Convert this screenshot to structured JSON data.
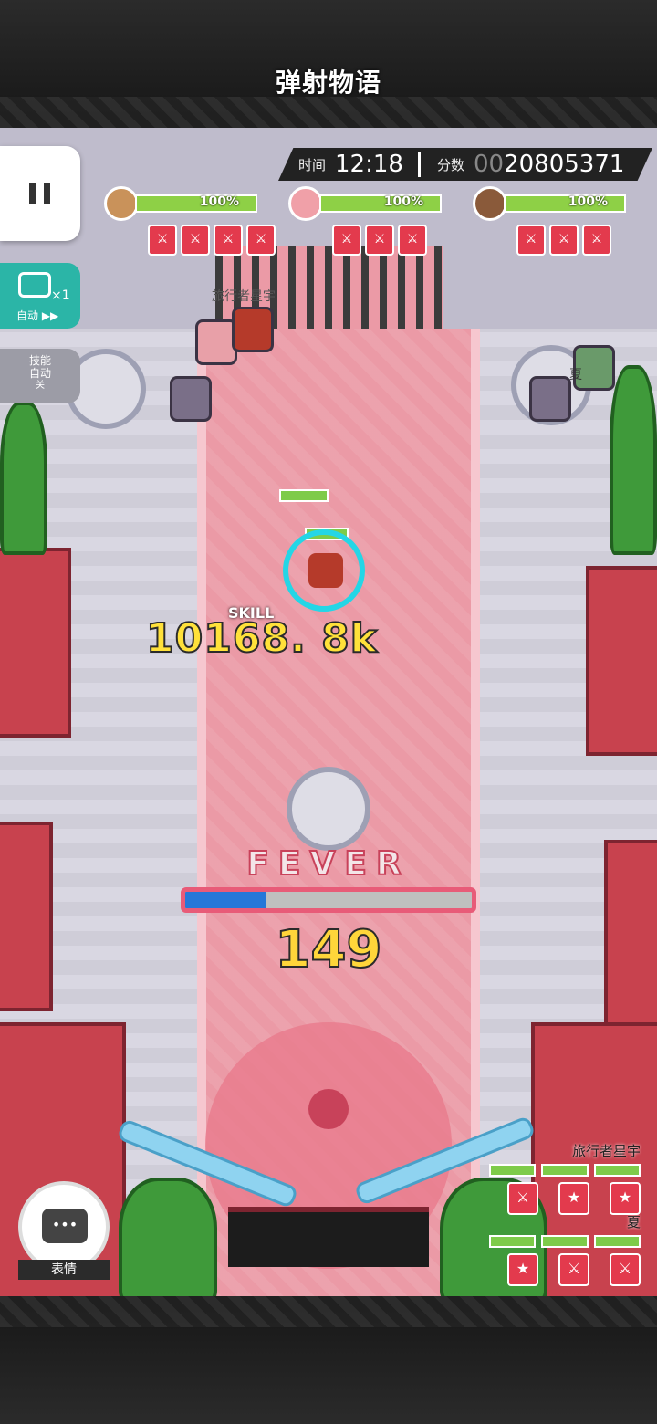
{
  "hud": {
    "time_label": "时间",
    "time_value": "12:18",
    "score_label": "分数",
    "score_prefix": "00",
    "score_value": "20805371"
  },
  "logo_text": "弹射物语",
  "side_controls": {
    "auto_multiplier": "×1",
    "auto_label": "自动 ▶▶",
    "skill_auto_line1": "技能",
    "skill_auto_line2": "自动",
    "skill_auto_state": "关"
  },
  "party": [
    {
      "hp_text": "100%",
      "skills": [
        "⚔",
        "⚔",
        "⚔",
        "⚔"
      ]
    },
    {
      "hp_text": "100%",
      "skills": [
        "⚔",
        "⚔",
        "⚔"
      ]
    },
    {
      "hp_text": "100%",
      "skills": [
        "⚔",
        "⚔",
        "⚔"
      ]
    }
  ],
  "field": {
    "player_tag": "旅行者星宇",
    "skill_text": "SKILL",
    "damage_text": "10168. 8k",
    "npc_tag": "夏"
  },
  "fever": {
    "title": "FEVER",
    "progress": 0.28,
    "combo": "149"
  },
  "chat": {
    "label": "表情",
    "icon_glyph": "•••"
  },
  "teammates": [
    {
      "name": "旅行者星宇",
      "skills": [
        "⚔",
        "★",
        "★"
      ]
    },
    {
      "name": "夏",
      "skills": [
        "★",
        "⚔",
        "⚔"
      ]
    }
  ],
  "colors": {
    "hp_green": "#8ed046",
    "fever_blue": "#2577d8",
    "accent_red": "#e33a4d",
    "auto_teal": "#2bb5a7",
    "combo_yellow": "#ffd63a"
  }
}
